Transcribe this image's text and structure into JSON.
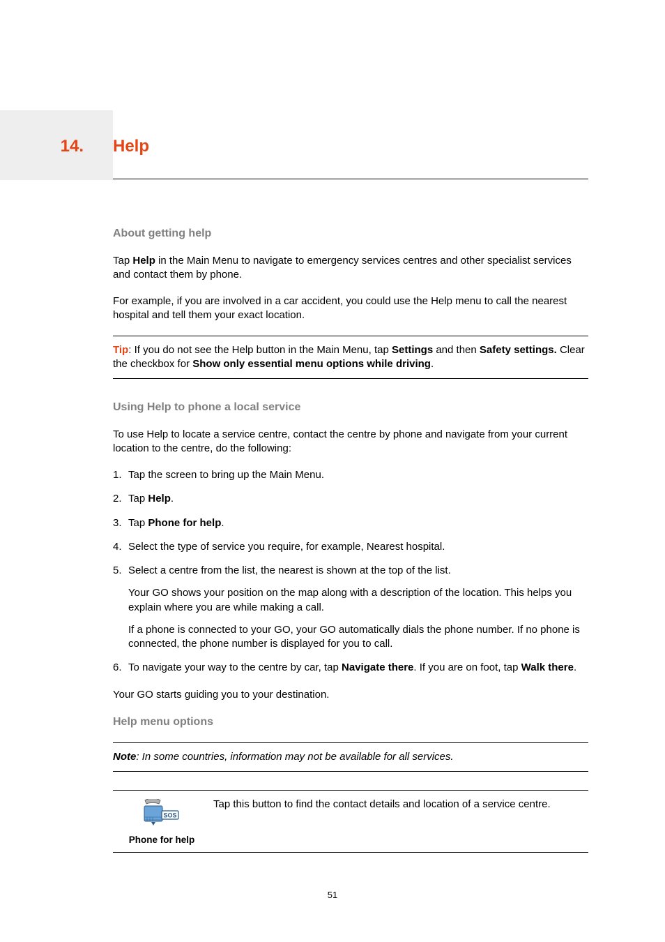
{
  "chapter": {
    "number": "14.",
    "title": "Help"
  },
  "section1": {
    "heading": "About getting help",
    "p1_pre": "Tap ",
    "p1_bold": "Help",
    "p1_post": " in the Main Menu to navigate to emergency services centres and other specialist services and contact them by phone.",
    "p2": "For example, if you are involved in a car accident, you could use the Help menu to call the nearest hospital and tell them your exact location."
  },
  "tip": {
    "label": "Tip",
    "t1": ": If you do not see the Help button in the Main Menu, tap ",
    "b1": "Settings",
    "t2": " and then ",
    "b2": "Safety settings.",
    "t3": " Clear the checkbox for ",
    "b3": "Show only essential menu options while driving",
    "t4": "."
  },
  "section2": {
    "heading": "Using Help to phone a local service",
    "intro": "To use Help to locate a service centre, contact the centre by phone and navigate from your current location to the centre, do the following:",
    "steps": {
      "s1": "Tap the screen to bring up the Main Menu.",
      "s2_pre": "Tap ",
      "s2_bold": "Help",
      "s2_post": ".",
      "s3_pre": "Tap ",
      "s3_bold": "Phone for help",
      "s3_post": ".",
      "s4": "Select the type of service you require, for example, Nearest hospital.",
      "s5": "Select a centre from the list, the nearest is shown at the top of the list.",
      "s5a": "Your GO shows your position on the map along with a description of the location. This helps you explain where you are while making a call.",
      "s5b": "If a phone is connected to your GO, your GO automatically dials the phone number. If no phone is connected, the phone number is displayed for you to call.",
      "s6_pre": "To navigate your way to the centre by car, tap ",
      "s6_b1": "Navigate there",
      "s6_mid": ". If you are on foot, tap ",
      "s6_b2": "Walk there",
      "s6_post": "."
    },
    "outro": "Your GO starts guiding you to your destination."
  },
  "section3": {
    "heading": "Help menu options",
    "note_label": "Note",
    "note_text": ": In some countries, information may not be available for all services.",
    "option1": {
      "label": "Phone for help",
      "desc": "Tap this button to find the contact details and location of a service centre.",
      "icon_sos": "SOS"
    }
  },
  "page_number": "51"
}
